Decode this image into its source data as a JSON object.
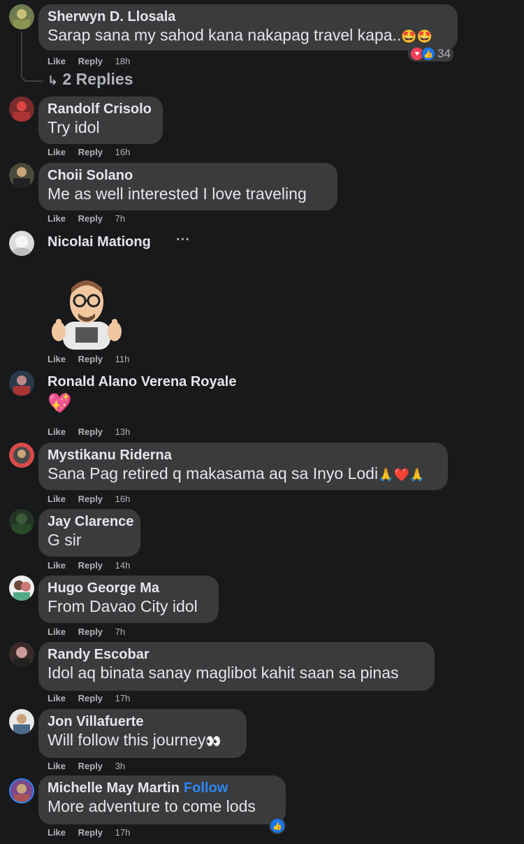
{
  "action_labels": {
    "like": "Like",
    "reply": "Reply"
  },
  "comments": [
    {
      "author": "Sherwyn D. Llosala",
      "text": "Sarap sana my sahod kana nakapag travel kapa..",
      "emojis": "🤩🤩",
      "time": "18h",
      "reaction_count": "34",
      "replies": "2 Replies"
    },
    {
      "author": "Randolf Crisolo",
      "text": "Try idol",
      "time": "16h"
    },
    {
      "author": "Choii Solano",
      "text": "Me as well interested I love traveling",
      "time": "7h"
    },
    {
      "author": "Nicolai Mationg",
      "text": "",
      "time": "11h",
      "sticker": "memoji-thumbs-up"
    },
    {
      "author": "Ronald Alano Verena Royale",
      "text": "💖",
      "time": "13h"
    },
    {
      "author": "Mystikanu Riderna",
      "text": "Sana Pag retired q makasama aq sa Inyo Lodi",
      "emojis": "🙏❤️🙏",
      "time": "16h"
    },
    {
      "author": "Jay Clarence",
      "text": "G sir",
      "time": "14h"
    },
    {
      "author": "Hugo George Ma",
      "text": "From Davao City idol",
      "time": "7h"
    },
    {
      "author": "Randy Escobar",
      "text": "Idol aq binata sanay maglibot kahit saan sa pinas",
      "time": "17h"
    },
    {
      "author": "Jon Villafuerte",
      "text": "Will follow this journey",
      "emojis": "👀",
      "time": "3h"
    },
    {
      "author": "Michelle May Martin",
      "follow": "Follow",
      "text": "More adventure to come lods",
      "time": "17h"
    }
  ],
  "colors": {
    "background": "#18191a",
    "bubble": "#3a3b3c",
    "accent": "#2d88ff",
    "muted": "#b0b3b8"
  }
}
